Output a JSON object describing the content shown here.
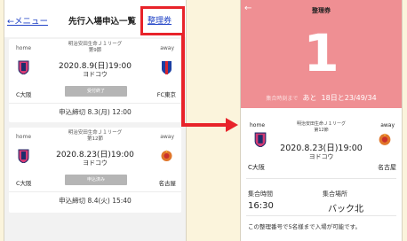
{
  "left_screen": {
    "header": {
      "back_label": "←メニュー",
      "title": "先行入場申込一覧",
      "ticket_link": "整理券"
    },
    "matches": [
      {
        "home_label": "home",
        "away_label": "away",
        "league": "明治安田生命Ｊ１リーグ",
        "round": "第9節",
        "datetime": "2020.8.9(日)19:00",
        "venue": "ヨドコウ",
        "home_team": "C大阪",
        "away_team": "FC東京",
        "status": "受付終了",
        "deadline": "申込締切 8.3(月) 12:00"
      },
      {
        "home_label": "home",
        "away_label": "away",
        "league": "明治安田生命Ｊ１リーグ",
        "round": "第12節",
        "datetime": "2020.8.23(日)19:00",
        "venue": "ヨドコウ",
        "home_team": "C大阪",
        "away_team": "名古屋",
        "status": "申込済み",
        "deadline": "申込締切 8.4(火) 15:40"
      }
    ]
  },
  "right_screen": {
    "back_icon": "←",
    "title": "整理券",
    "ticket_number": "1",
    "countdown_label": "集合時刻まで",
    "countdown_prefix": "あと",
    "countdown_value": "18日と23/49/34",
    "match": {
      "home_label": "home",
      "away_label": "away",
      "league": "明治安田生命Ｊ１リーグ",
      "round": "第12節",
      "datetime": "2020.8.23(日)19:00",
      "venue": "ヨドコウ",
      "home_team": "C大阪",
      "away_team": "名古屋"
    },
    "assembly_time_label": "集合時間",
    "assembly_time": "16:30",
    "assembly_place_label": "集合場所",
    "assembly_place": "バック北",
    "notice": "この整理番号で5名様まで入場が可能です。"
  },
  "colors": {
    "background": "#fbf4dc",
    "accent_red": "#e8232a",
    "ticket_pink": "#ef8f93",
    "link_blue": "#2345c7"
  }
}
